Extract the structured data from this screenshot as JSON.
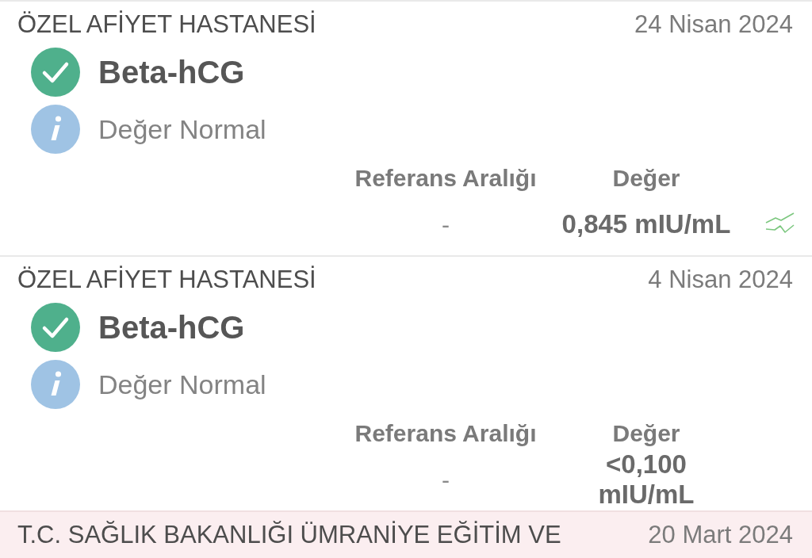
{
  "results": [
    {
      "hospital": "ÖZEL AFİYET HASTANESİ",
      "date": "24 Nisan 2024",
      "highlighted": false,
      "test": {
        "name": "Beta-hCG",
        "status": "Değer Normal"
      },
      "columns": [
        "Referans Aralığı",
        "Değer"
      ],
      "reference_range": "-",
      "value": "0,845 mIU/mL",
      "trend_icon": true
    },
    {
      "hospital": "ÖZEL AFİYET HASTANESİ",
      "date": "4 Nisan 2024",
      "highlighted": false,
      "test": {
        "name": "Beta-hCG",
        "status": "Değer Normal"
      },
      "columns": [
        "Referans Aralığı",
        "Değer"
      ],
      "reference_range": "-",
      "value": "<0,100 mIU/mL",
      "trend_icon": false
    },
    {
      "hospital": "T.C. SAĞLIK BAKANLIĞI ÜMRANİYE EĞİTİM VE",
      "date": "20 Mart 2024",
      "highlighted": true
    }
  ]
}
